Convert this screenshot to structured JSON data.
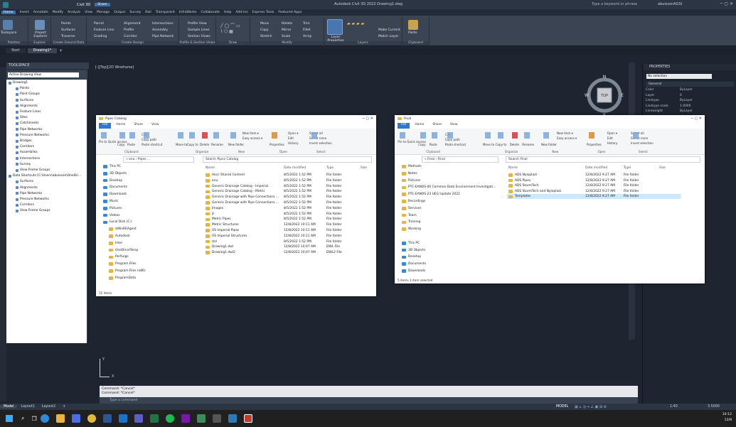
{
  "app": {
    "title": "Autodesk Civil 3D 2022   Drawing1.dwg",
    "product": "Civil 3D",
    "share_label": "Share",
    "search_placeholder": "Type a keyword or phrase",
    "user": "abuissonAGSI"
  },
  "menu": [
    "Home",
    "Insert",
    "Annotate",
    "Modify",
    "Analyze",
    "View",
    "Manage",
    "Output",
    "Survey",
    "Rail",
    "Transparent",
    "InfraWorks",
    "Collaborate",
    "Help",
    "Add-ins",
    "Express Tools",
    "Featured Apps"
  ],
  "ribbon": {
    "palettes": {
      "toolspace": "Toolspace",
      "label": "Palettes"
    },
    "explore": {
      "project": "Project Explorer",
      "label": "Explore"
    },
    "ground": {
      "items": [
        "Points",
        "Surfaces",
        "Traverse"
      ],
      "label": "Create Ground Data"
    },
    "design": {
      "items": [
        "Parcel",
        "Feature Line",
        "Grading",
        "Alignment",
        "Profile",
        "Corridor",
        "Intersections",
        "Assembly",
        "Pipe Network"
      ],
      "label": "Create Design"
    },
    "profile": {
      "items": [
        "Profile View",
        "Sample Lines",
        "Section Views"
      ],
      "label": "Profile & Section Views"
    },
    "draw": {
      "label": "Draw"
    },
    "modify": {
      "items": [
        "Move",
        "Copy",
        "Stretch",
        "Rotate",
        "Mirror",
        "Scale",
        "Trim",
        "Fillet",
        "Array"
      ],
      "label": "Modify"
    },
    "layers": {
      "big": "Layer Properties",
      "items": [
        "Make Current",
        "Match Layer"
      ],
      "label": "Layers"
    },
    "clipboard": {
      "big": "Paste",
      "label": "Clipboard"
    }
  },
  "doctabs": [
    "Start",
    "Drawing1*"
  ],
  "toolspace": {
    "header": "TOOLSPACE",
    "view": "Active Drawing View",
    "items": [
      {
        "label": "Drawing1",
        "indent": 0
      },
      {
        "label": "Points",
        "indent": 1
      },
      {
        "label": "Point Groups",
        "indent": 1
      },
      {
        "label": "Surfaces",
        "indent": 1
      },
      {
        "label": "Alignments",
        "indent": 1
      },
      {
        "label": "Feature Lines",
        "indent": 1
      },
      {
        "label": "Sites",
        "indent": 1
      },
      {
        "label": "Catchments",
        "indent": 1
      },
      {
        "label": "Pipe Networks",
        "indent": 1
      },
      {
        "label": "Pressure Networks",
        "indent": 1
      },
      {
        "label": "Bridges",
        "indent": 1
      },
      {
        "label": "Corridors",
        "indent": 1
      },
      {
        "label": "Assemblies",
        "indent": 1
      },
      {
        "label": "Intersections",
        "indent": 1
      },
      {
        "label": "Survey",
        "indent": 1
      },
      {
        "label": "View Frame Groups",
        "indent": 1
      },
      {
        "label": "Data Shortcuts [C:\\Users\\abuisson\\OneDri...",
        "indent": 0
      },
      {
        "label": "Surfaces",
        "indent": 1
      },
      {
        "label": "Alignments",
        "indent": 1
      },
      {
        "label": "Pipe Networks",
        "indent": 1
      },
      {
        "label": "Pressure Networks",
        "indent": 1
      },
      {
        "label": "Corridors",
        "indent": 1
      },
      {
        "label": "View Frame Groups",
        "indent": 1
      }
    ]
  },
  "viewport_label": "[-][Top][2D Wireframe]",
  "compass": {
    "n": "N",
    "s": "S",
    "e": "E",
    "w": "W",
    "top": "TOP"
  },
  "properties": {
    "header": "PROPERTIES",
    "selection": "No selection",
    "section": "General",
    "rows": [
      {
        "k": "Color",
        "v": "ByLayer"
      },
      {
        "k": "Layer",
        "v": "0"
      },
      {
        "k": "Linetype",
        "v": "ByLayer"
      },
      {
        "k": "Linetype scale",
        "v": "1.0000"
      },
      {
        "k": "Lineweight",
        "v": "ByLayer"
      }
    ]
  },
  "explorer_tabs": [
    "File",
    "Home",
    "Share",
    "View"
  ],
  "ribbon_common": {
    "pin": "Pin to Quick access",
    "copy": "Copy",
    "paste": "Paste",
    "cut": "Cut",
    "copy_path": "Copy path",
    "paste_shortcut": "Paste shortcut",
    "move_to": "Move to",
    "copy_to": "Copy to",
    "delete": "Delete",
    "rename": "Rename",
    "new_folder": "New folder",
    "new_item": "New item ▾",
    "easy_access": "Easy access ▾",
    "properties": "Properties",
    "open": "Open ▾",
    "edit": "Edit",
    "history": "History",
    "select_all": "Select all",
    "select_none": "Select none",
    "invert": "Invert selection",
    "groups": [
      "Clipboard",
      "Organize",
      "New",
      "Open",
      "Select"
    ]
  },
  "explorer1": {
    "title": "Pipes Catalog",
    "address": "«  enu  ›  Pipes ...",
    "search": "Search Pipes Catalog",
    "cols": [
      "Name",
      "Date modified",
      "Type",
      "Size"
    ],
    "nav": [
      {
        "label": "This PC",
        "icon": "blue"
      },
      {
        "label": "3D Objects",
        "icon": "blue"
      },
      {
        "label": "Desktop",
        "icon": "blue"
      },
      {
        "label": "Documents",
        "icon": "blue"
      },
      {
        "label": "Downloads",
        "icon": "blue"
      },
      {
        "label": "Music",
        "icon": "blue"
      },
      {
        "label": "Pictures",
        "icon": "blue"
      },
      {
        "label": "Videos",
        "icon": "blue"
      },
      {
        "label": "Local Disk (C:)",
        "icon": "blue"
      },
      {
        "label": "$WinREAgent",
        "icon": "fold"
      },
      {
        "label": "Autodesk",
        "icon": "fold"
      },
      {
        "label": "Intel",
        "icon": "fold"
      },
      {
        "label": "OneDriveTemp",
        "icon": "fold"
      },
      {
        "label": "PerfLogs",
        "icon": "fold"
      },
      {
        "label": "Program Files",
        "icon": "fold"
      },
      {
        "label": "Program Files (x86)",
        "icon": "fold"
      },
      {
        "label": "ProgramData",
        "icon": "fold"
      }
    ],
    "files": [
      {
        "name": "Aecc Shared Content",
        "date": "8/5/2022 1:52 PM",
        "type": "File folder",
        "size": ""
      },
      {
        "name": "enu",
        "date": "8/5/2022 1:52 PM",
        "type": "File folder",
        "size": ""
      },
      {
        "name": "Generic Drainage Catalog - Imperial",
        "date": "8/5/2022 1:52 PM",
        "type": "File folder",
        "size": ""
      },
      {
        "name": "Generic Drainage Catalog - Metric",
        "date": "8/5/2022 1:52 PM",
        "type": "File folder",
        "size": ""
      },
      {
        "name": "Generic Drainage with Pipe Connections ...",
        "date": "8/5/2022 1:52 PM",
        "type": "File folder",
        "size": ""
      },
      {
        "name": "Generic Drainage with Pipe Connections ...",
        "date": "8/5/2022 1:52 PM",
        "type": "File folder",
        "size": ""
      },
      {
        "name": "Images",
        "date": "8/5/2022 1:52 PM",
        "type": "File folder",
        "size": ""
      },
      {
        "name": "jt",
        "date": "8/5/2022 1:52 PM",
        "type": "File folder",
        "size": ""
      },
      {
        "name": "Metric Pipes",
        "date": "8/5/2022 1:52 PM",
        "type": "File folder",
        "size": ""
      },
      {
        "name": "Metric Structures",
        "date": "12/8/2022 10:11 AM",
        "type": "File folder",
        "size": ""
      },
      {
        "name": "US Imperial Pipes",
        "date": "12/8/2022 10:11 AM",
        "type": "File folder",
        "size": ""
      },
      {
        "name": "US Imperial Structures",
        "date": "12/8/2022 10:11 AM",
        "type": "File folder",
        "size": ""
      },
      {
        "name": "std",
        "date": "8/5/2022 1:52 PM",
        "type": "File folder",
        "size": ""
      },
      {
        "name": "Drawing1.dwl",
        "date": "12/8/2022 10:07 AM",
        "type": "DWL File",
        "size": ""
      },
      {
        "name": "Drawing1.dwl2",
        "date": "12/8/2022 10:07 AM",
        "type": "DWL2 File",
        "size": ""
      }
    ],
    "status": "15 items"
  },
  "explorer2": {
    "title": "Final",
    "address": "«  Final  ›  Final",
    "search": "Search Final",
    "cols": [
      "Name",
      "Date modified",
      "Type",
      "Size"
    ],
    "nav": [
      {
        "label": "Methods",
        "icon": "fold"
      },
      {
        "label": "Notes",
        "icon": "fold"
      },
      {
        "label": "Pictures",
        "icon": "fold"
      },
      {
        "label": "PTC-EANOS-00 Common Data Environment Investigati...",
        "icon": "fold"
      },
      {
        "label": "PTC-EANOS-23 UEG Update 2022",
        "icon": "fold"
      },
      {
        "label": "Recordings",
        "icon": "fold"
      },
      {
        "label": "Services",
        "icon": "fold"
      },
      {
        "label": "Team",
        "icon": "fold"
      },
      {
        "label": "Training",
        "icon": "fold"
      },
      {
        "label": "Working",
        "icon": "fold"
      },
      {
        "label": "",
        "icon": "none"
      },
      {
        "label": "This PC",
        "icon": "blue"
      },
      {
        "label": "3D Objects",
        "icon": "blue"
      },
      {
        "label": "Desktop",
        "icon": "blue"
      },
      {
        "label": "Documents",
        "icon": "blue"
      },
      {
        "label": "Downloads",
        "icon": "blue"
      }
    ],
    "files": [
      {
        "name": "ADS Nyloplast",
        "date": "12/8/2022 9:27 AM",
        "type": "File folder",
        "size": ""
      },
      {
        "name": "ADS Pipes",
        "date": "12/8/2022 9:27 AM",
        "type": "File folder",
        "size": ""
      },
      {
        "name": "ADS StormTech",
        "date": "12/8/2022 9:27 AM",
        "type": "File folder",
        "size": ""
      },
      {
        "name": "ADS StormTech and Nyloplast",
        "date": "12/8/2022 9:27 AM",
        "type": "File folder",
        "size": ""
      },
      {
        "name": "Templates",
        "date": "12/8/2022 9:27 AM",
        "type": "File folder",
        "size": ""
      }
    ],
    "status": "5 items    1 item selected"
  },
  "command": {
    "lines": [
      "Command: *Cancel*",
      "Command: *Cancel*"
    ],
    "placeholder": "Type a command"
  },
  "layout_tabs": [
    "Model",
    "Layout1",
    "Layout2",
    "+"
  ],
  "status_right": {
    "model": "MODEL",
    "scale": "1:40",
    "value": "3.5000"
  },
  "clock": {
    "time": "10:12",
    "date": "12/8"
  },
  "colors": {
    "accent": "#2b79d0",
    "ribbon": "#3b4453",
    "bg": "#1e2531"
  }
}
